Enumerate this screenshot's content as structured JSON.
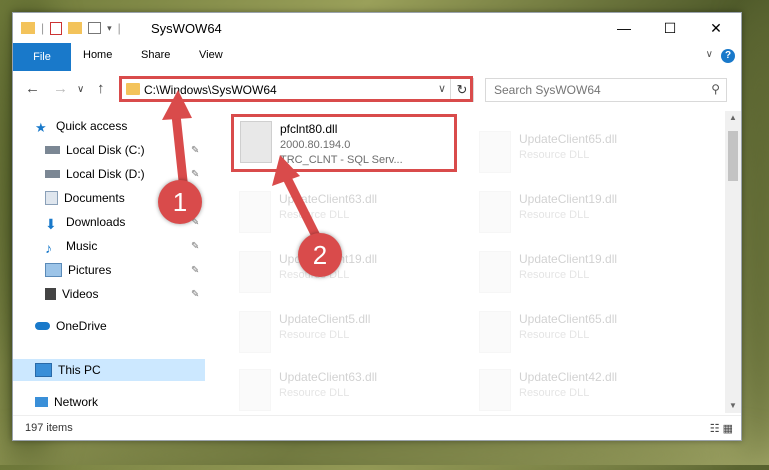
{
  "window": {
    "title": "SysWOW64"
  },
  "ribbon": {
    "tabs": [
      "File",
      "Home",
      "Share",
      "View"
    ]
  },
  "address": {
    "path": "C:\\Windows\\SysWOW64"
  },
  "search": {
    "placeholder": "Search SysWOW64"
  },
  "sidebar": {
    "items": [
      {
        "label": "Quick access",
        "icon": "star-icon"
      },
      {
        "label": "Local Disk (C:)",
        "icon": "drive-icon"
      },
      {
        "label": "Local Disk (D:)",
        "icon": "drive-icon"
      },
      {
        "label": "Documents",
        "icon": "documents-icon"
      },
      {
        "label": "Downloads",
        "icon": "downloads-icon"
      },
      {
        "label": "Music",
        "icon": "music-icon"
      },
      {
        "label": "Pictures",
        "icon": "pictures-icon"
      },
      {
        "label": "Videos",
        "icon": "videos-icon"
      },
      {
        "label": "OneDrive",
        "icon": "onedrive-icon"
      },
      {
        "label": "This PC",
        "icon": "computer-icon"
      },
      {
        "label": "Network",
        "icon": "network-icon"
      }
    ]
  },
  "files": [
    {
      "name": "pfclnt80.dll",
      "line1": "2000.80.194.0",
      "line2": "TRC_CLNT - SQL Serv..."
    },
    {
      "name": "UpdateClient65.dll",
      "line1": "Resource DLL"
    },
    {
      "name": "UpdateClient63.dll",
      "line1": "Resource DLL"
    },
    {
      "name": "UpdateClient19.dll",
      "line1": "Resource DLL"
    },
    {
      "name": "UpdateClient19.dll",
      "line1": "Resource DLL"
    },
    {
      "name": "UpdateClient19.dll",
      "line1": "Resource DLL"
    },
    {
      "name": "UpdateClient5.dll",
      "line1": "Resource DLL"
    },
    {
      "name": "UpdateClient65.dll",
      "line1": "Resource DLL"
    },
    {
      "name": "UpdateClient63.dll",
      "line1": "Resource DLL"
    },
    {
      "name": "UpdateClient42.dll",
      "line1": "Resource DLL"
    }
  ],
  "status": {
    "item_count": "197 items"
  },
  "callouts": [
    "1",
    "2"
  ],
  "colors": {
    "accent": "#1979ca",
    "highlight": "#d94b4b",
    "folder": "#f3c35b"
  }
}
